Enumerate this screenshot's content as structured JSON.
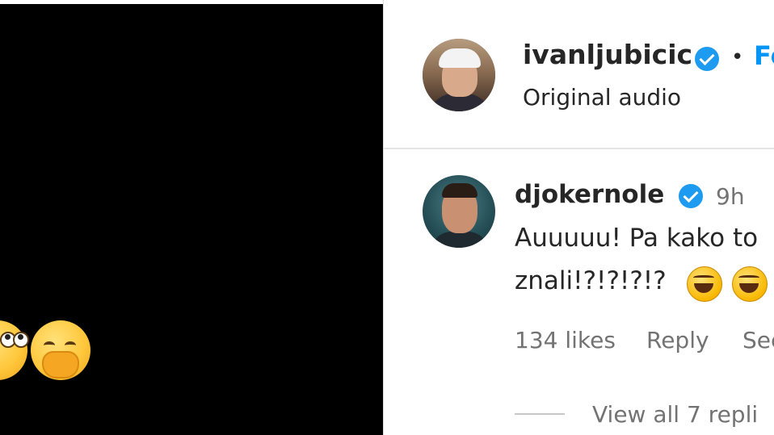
{
  "post": {
    "author": "ivanljubicic",
    "separator": "•",
    "follow_label": "Fo",
    "subtitle": "Original audio"
  },
  "comment": {
    "author": "djokernole",
    "time": "9h",
    "text_line1": "Auuuuu! Pa kako to",
    "text_line2": "znali!?!?!?!?",
    "likes": "134 likes",
    "reply_label": "Reply",
    "see_label": "See",
    "view_replies": "View all 7 repli"
  },
  "icons": {
    "verified": "verified-badge-icon",
    "laughing": "rolling-on-floor-laughing-emoji",
    "face_roll": "face-with-rolling-eyes-emoji",
    "face_hand": "face-with-hand-over-mouth-emoji"
  },
  "colors": {
    "verified": "#1d9bf0",
    "follow": "#0095f6",
    "text": "#262626",
    "muted": "#737373"
  }
}
